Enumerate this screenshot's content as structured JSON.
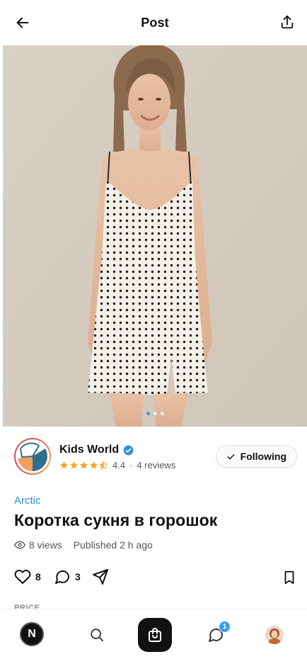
{
  "header": {
    "title": "Post",
    "back_icon": "arrow-left-icon",
    "share_icon": "share-icon"
  },
  "gallery": {
    "image_description": "product photo",
    "page_count": 3,
    "active_index": 0,
    "active_dot_color": "#4a90d9"
  },
  "seller": {
    "name": "Kids World",
    "verified": true,
    "rating_value": "4.4",
    "separator": "·",
    "reviews_text": "4 reviews",
    "stars_filled": 4.4,
    "star_color": "#f5a623",
    "follow_label": "Following"
  },
  "post": {
    "category": "Arctic",
    "title": "Коротка сукня в горошок",
    "views_text": "8 views",
    "published_text": "Published 2 h ago"
  },
  "actions": {
    "likes": "8",
    "comments": "3"
  },
  "price_label": "PRICE",
  "bottom_nav": {
    "home_badge_letter": "N",
    "chat_badge_count": "1",
    "accent": "#3b9de8"
  },
  "colors": {
    "link_blue": "#2f8fdc",
    "text_primary": "#111111",
    "text_secondary": "#555555"
  }
}
